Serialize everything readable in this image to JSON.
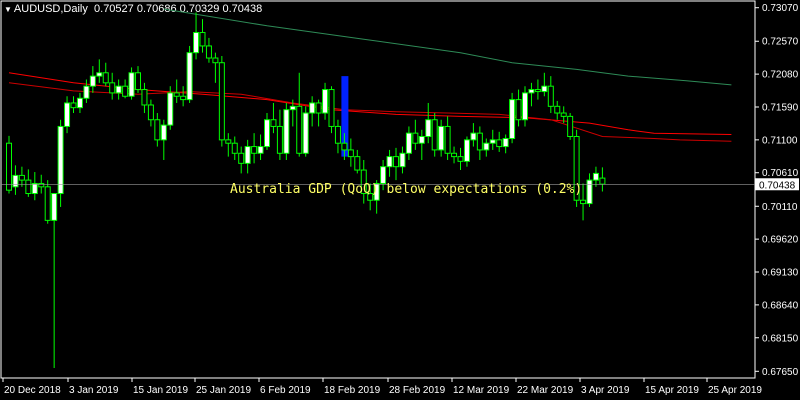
{
  "header": {
    "symbol": "AUDUSD,Daily",
    "ohlc": "0.70527 0.70686 0.70329 0.70438"
  },
  "colors": {
    "background": "#000000",
    "bull_candle": "#ffffff",
    "bear_candle": "#000000",
    "wick": "#00ff00",
    "ma_long": "#2e8b57",
    "ma_mid": "#ff0000",
    "ma_short": "#cc0000",
    "annotation": "#ffff66",
    "highlight": "#0022ff"
  },
  "chart_data": {
    "type": "candlestick",
    "symbol": "AUDUSD",
    "timeframe": "Daily",
    "ylim": [
      0.6755,
      0.7317
    ],
    "y_ticks": [
      "0.73070",
      "0.72570",
      "0.72080",
      "0.71590",
      "0.71100",
      "0.70610",
      "0.70110",
      "0.69620",
      "0.69130",
      "0.68640",
      "0.68150",
      "0.67650"
    ],
    "x_ticks": [
      "20 Dec 2018",
      "3 Jan 2019",
      "15 Jan 2019",
      "25 Jan 2019",
      "6 Feb 2019",
      "18 Feb 2019",
      "28 Feb 2019",
      "12 Mar 2019",
      "22 Mar 2019",
      "3 Apr 2019",
      "15 Apr 2019",
      "25 Apr 2019"
    ],
    "current_price": "0.70438",
    "annotation": "Australia GDP (QoQ) below expectations (0.2%)",
    "candles": [
      [
        0.7105,
        0.7116,
        0.703,
        0.7035
      ],
      [
        0.704,
        0.7072,
        0.7028,
        0.7057
      ],
      [
        0.7057,
        0.707,
        0.704,
        0.705
      ],
      [
        0.705,
        0.7066,
        0.7025,
        0.703
      ],
      [
        0.703,
        0.7062,
        0.702,
        0.7045
      ],
      [
        0.7045,
        0.7058,
        0.703,
        0.704
      ],
      [
        0.704,
        0.705,
        0.6985,
        0.699
      ],
      [
        0.699,
        0.702,
        0.677,
        0.703
      ],
      [
        0.703,
        0.714,
        0.701,
        0.713
      ],
      [
        0.713,
        0.7175,
        0.712,
        0.7165
      ],
      [
        0.7165,
        0.7175,
        0.715,
        0.7158
      ],
      [
        0.7158,
        0.718,
        0.715,
        0.7172
      ],
      [
        0.7172,
        0.72,
        0.7165,
        0.719
      ],
      [
        0.719,
        0.722,
        0.718,
        0.7205
      ],
      [
        0.7205,
        0.723,
        0.7195,
        0.721
      ],
      [
        0.721,
        0.7225,
        0.719,
        0.7195
      ],
      [
        0.7195,
        0.721,
        0.717,
        0.718
      ],
      [
        0.718,
        0.72,
        0.717,
        0.719
      ],
      [
        0.719,
        0.72,
        0.7172,
        0.7175
      ],
      [
        0.7175,
        0.7218,
        0.717,
        0.721
      ],
      [
        0.721,
        0.722,
        0.718,
        0.7185
      ],
      [
        0.7185,
        0.7195,
        0.715,
        0.7162
      ],
      [
        0.7162,
        0.717,
        0.713,
        0.714
      ],
      [
        0.714,
        0.715,
        0.71,
        0.711
      ],
      [
        0.711,
        0.714,
        0.708,
        0.7132
      ],
      [
        0.7132,
        0.719,
        0.7125,
        0.718
      ],
      [
        0.718,
        0.72,
        0.7165,
        0.7175
      ],
      [
        0.7175,
        0.719,
        0.716,
        0.717
      ],
      [
        0.717,
        0.725,
        0.7165,
        0.724
      ],
      [
        0.724,
        0.73,
        0.723,
        0.727
      ],
      [
        0.727,
        0.729,
        0.724,
        0.725
      ],
      [
        0.725,
        0.7262,
        0.7225,
        0.7232
      ],
      [
        0.7232,
        0.724,
        0.7195,
        0.7225
      ],
      [
        0.7225,
        0.7235,
        0.71,
        0.711
      ],
      [
        0.711,
        0.712,
        0.7085,
        0.7105
      ],
      [
        0.7105,
        0.7115,
        0.708,
        0.709
      ],
      [
        0.709,
        0.71,
        0.706,
        0.7075
      ],
      [
        0.7075,
        0.711,
        0.706,
        0.71
      ],
      [
        0.71,
        0.712,
        0.7075,
        0.709
      ],
      [
        0.709,
        0.7118,
        0.708,
        0.71
      ],
      [
        0.71,
        0.715,
        0.7095,
        0.714
      ],
      [
        0.714,
        0.7165,
        0.712,
        0.713
      ],
      [
        0.713,
        0.7155,
        0.708,
        0.709
      ],
      [
        0.709,
        0.7165,
        0.708,
        0.7155
      ],
      [
        0.7155,
        0.717,
        0.713,
        0.716
      ],
      [
        0.716,
        0.721,
        0.7085,
        0.709
      ],
      [
        0.709,
        0.716,
        0.7085,
        0.715
      ],
      [
        0.715,
        0.7175,
        0.713,
        0.7165
      ],
      [
        0.7165,
        0.717,
        0.713,
        0.715
      ],
      [
        0.715,
        0.7195,
        0.714,
        0.7185
      ],
      [
        0.7185,
        0.719,
        0.712,
        0.713
      ],
      [
        0.713,
        0.714,
        0.709,
        0.7105
      ],
      [
        0.7105,
        0.712,
        0.708,
        0.7095
      ],
      [
        0.7095,
        0.7112,
        0.707,
        0.7085
      ],
      [
        0.7085,
        0.7095,
        0.706,
        0.7065
      ],
      [
        0.7065,
        0.708,
        0.7015,
        0.703
      ],
      [
        0.703,
        0.7045,
        0.7005,
        0.702
      ],
      [
        0.702,
        0.705,
        0.7,
        0.7045
      ],
      [
        0.7045,
        0.708,
        0.7035,
        0.707
      ],
      [
        0.707,
        0.7095,
        0.7055,
        0.7085
      ],
      [
        0.7085,
        0.7098,
        0.705,
        0.707
      ],
      [
        0.707,
        0.71,
        0.706,
        0.709
      ],
      [
        0.709,
        0.713,
        0.708,
        0.712
      ],
      [
        0.712,
        0.714,
        0.7095,
        0.7105
      ],
      [
        0.7105,
        0.7125,
        0.708,
        0.7115
      ],
      [
        0.7115,
        0.7165,
        0.7105,
        0.714
      ],
      [
        0.714,
        0.715,
        0.7085,
        0.7095
      ],
      [
        0.7095,
        0.714,
        0.7085,
        0.713
      ],
      [
        0.713,
        0.7145,
        0.708,
        0.709
      ],
      [
        0.709,
        0.71,
        0.7075,
        0.7085
      ],
      [
        0.7085,
        0.7098,
        0.7065,
        0.7078
      ],
      [
        0.7078,
        0.7115,
        0.707,
        0.711
      ],
      [
        0.711,
        0.7135,
        0.71,
        0.712
      ],
      [
        0.712,
        0.713,
        0.708,
        0.7095
      ],
      [
        0.7095,
        0.7112,
        0.7085,
        0.7105
      ],
      [
        0.7105,
        0.7125,
        0.7095,
        0.711
      ],
      [
        0.711,
        0.7122,
        0.7092,
        0.71
      ],
      [
        0.71,
        0.7118,
        0.709,
        0.7112
      ],
      [
        0.7112,
        0.718,
        0.7105,
        0.717
      ],
      [
        0.717,
        0.7185,
        0.713,
        0.714
      ],
      [
        0.714,
        0.719,
        0.713,
        0.718
      ],
      [
        0.718,
        0.7195,
        0.716,
        0.7185
      ],
      [
        0.7185,
        0.72,
        0.717,
        0.7182
      ],
      [
        0.7182,
        0.721,
        0.7175,
        0.719
      ],
      [
        0.719,
        0.7205,
        0.715,
        0.716
      ],
      [
        0.716,
        0.7168,
        0.714,
        0.715
      ],
      [
        0.715,
        0.716,
        0.7135,
        0.7145
      ],
      [
        0.7145,
        0.715,
        0.711,
        0.7115
      ],
      [
        0.7115,
        0.7125,
        0.701,
        0.702
      ],
      [
        0.702,
        0.7045,
        0.699,
        0.7015
      ],
      [
        0.7015,
        0.706,
        0.701,
        0.705
      ],
      [
        0.705,
        0.707,
        0.704,
        0.706
      ],
      [
        0.7053,
        0.7069,
        0.7033,
        0.7044
      ]
    ],
    "ma_long": [
      [
        24,
        0.7305
      ],
      [
        40,
        0.728
      ],
      [
        55,
        0.726
      ],
      [
        70,
        0.724
      ],
      [
        78,
        0.7225
      ],
      [
        88,
        0.7215
      ],
      [
        96,
        0.7205
      ],
      [
        105,
        0.7198
      ],
      [
        112,
        0.7192
      ]
    ],
    "ma_mid": [
      [
        0,
        0.721
      ],
      [
        10,
        0.7195
      ],
      [
        20,
        0.7185
      ],
      [
        30,
        0.7178
      ],
      [
        40,
        0.717
      ],
      [
        50,
        0.7155
      ],
      [
        60,
        0.7148
      ],
      [
        70,
        0.7145
      ],
      [
        80,
        0.7143
      ],
      [
        90,
        0.7135
      ],
      [
        96,
        0.7125
      ],
      [
        100,
        0.712
      ],
      [
        112,
        0.7118
      ]
    ],
    "ma_short": [
      [
        0,
        0.7195
      ],
      [
        10,
        0.7183
      ],
      [
        20,
        0.7178
      ],
      [
        28,
        0.7182
      ],
      [
        36,
        0.7178
      ],
      [
        44,
        0.7165
      ],
      [
        52,
        0.7155
      ],
      [
        60,
        0.7152
      ],
      [
        68,
        0.715
      ],
      [
        76,
        0.7148
      ],
      [
        84,
        0.714
      ],
      [
        92,
        0.7115
      ],
      [
        100,
        0.7112
      ],
      [
        104,
        0.711
      ],
      [
        112,
        0.7108
      ]
    ]
  }
}
